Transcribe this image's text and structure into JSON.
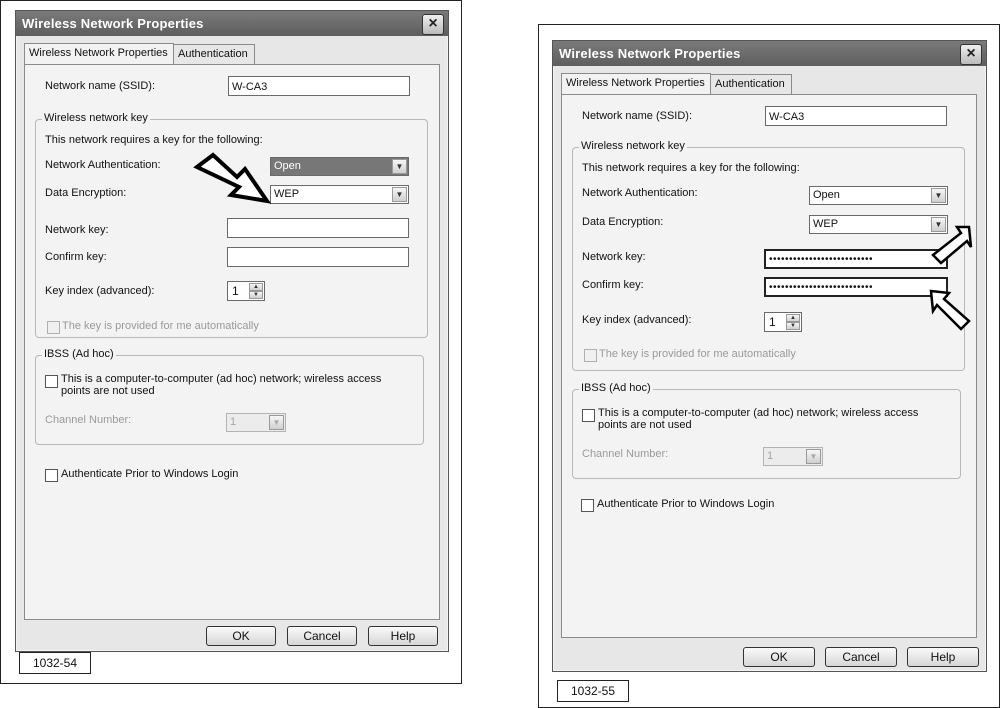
{
  "figures": [
    {
      "label": "1032-54",
      "dialog": {
        "title": "Wireless Network Properties",
        "close_icon": "×",
        "tabs": [
          "Wireless Network Properties",
          "Authentication"
        ],
        "ssid_label": "Network name (SSID):",
        "ssid_value": "W-CA3",
        "key_group_title": "Wireless network key",
        "key_intro": "This network requires a key for the following:",
        "auth_label": "Network Authentication:",
        "auth_value": "Open",
        "encryption_label": "Data Encryption:",
        "encryption_value": "WEP",
        "network_key_label": "Network key:",
        "network_key_value": "",
        "confirm_key_label": "Confirm key:",
        "confirm_key_value": "",
        "key_index_label": "Key index (advanced):",
        "key_index_value": "1",
        "auto_key_label": "The key is provided for me automatically",
        "ibss_group_title": "IBSS (Ad hoc)",
        "adhoc_label": "This is a computer-to-computer (ad hoc) network; wireless access points are not used",
        "channel_label": "Channel Number:",
        "channel_value": "1",
        "auth_prior_label": "Authenticate Prior to Windows Login",
        "ok": "OK",
        "cancel": "Cancel",
        "help": "Help"
      }
    },
    {
      "label": "1032-55",
      "dialog": {
        "title": "Wireless Network Properties",
        "close_icon": "×",
        "tabs": [
          "Wireless Network Properties",
          "Authentication"
        ],
        "ssid_label": "Network name (SSID):",
        "ssid_value": "W-CA3",
        "key_group_title": "Wireless network key",
        "key_intro": "This network requires a key for the following:",
        "auth_label": "Network Authentication:",
        "auth_value": "Open",
        "encryption_label": "Data Encryption:",
        "encryption_value": "WEP",
        "network_key_label": "Network key:",
        "network_key_value": "••••••••••••••••••••••••••",
        "confirm_key_label": "Confirm key:",
        "confirm_key_value": "••••••••••••••••••••••••••",
        "key_index_label": "Key index (advanced):",
        "key_index_value": "1",
        "auto_key_label": "The key is provided for me automatically",
        "ibss_group_title": "IBSS (Ad hoc)",
        "adhoc_label": "This is a computer-to-computer (ad hoc) network; wireless access points are not used",
        "channel_label": "Channel Number:",
        "channel_value": "1",
        "auth_prior_label": "Authenticate Prior to Windows Login",
        "ok": "OK",
        "cancel": "Cancel",
        "help": "Help"
      }
    }
  ],
  "annotations": {
    "pointer_icon": "outline-arrow-icon"
  }
}
